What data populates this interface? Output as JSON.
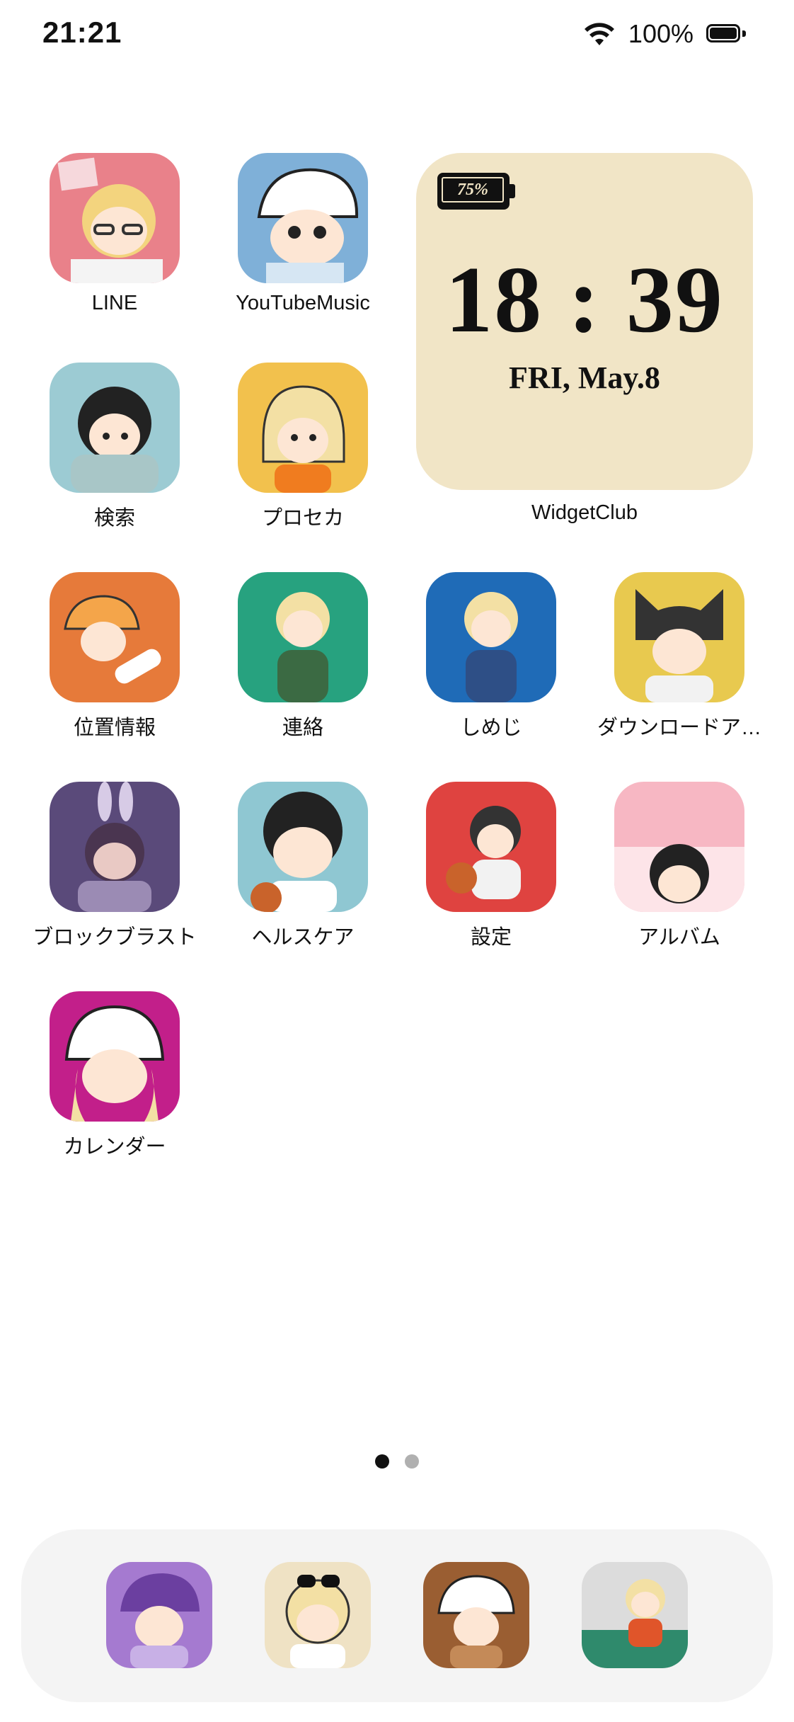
{
  "status_bar": {
    "time": "21:21",
    "battery_percent": "100%",
    "icons": [
      "wifi-icon",
      "battery-icon"
    ]
  },
  "apps": [
    {
      "label": "LINE",
      "bg": "#e9818a"
    },
    {
      "label": "YouTubeMusic",
      "bg": "#7fb0d8"
    },
    {
      "label": "検索",
      "bg": "#9ccbd3"
    },
    {
      "label": "プロセカ",
      "bg": "#f2c14d"
    },
    {
      "label": "位置情報",
      "bg": "#e67a3a"
    },
    {
      "label": "連絡",
      "bg": "#27a27f"
    },
    {
      "label": "しめじ",
      "bg": "#1f6bb7"
    },
    {
      "label": "ダウンロードア…",
      "bg": "#e8c94f"
    },
    {
      "label": "ブロックブラスト",
      "bg": "#5a4a7a"
    },
    {
      "label": "ヘルスケア",
      "bg": "#8fc7d2"
    },
    {
      "label": "設定",
      "bg": "#df4340"
    },
    {
      "label": "アルバム",
      "bg": "#f7b7c3"
    },
    {
      "label": "カレンダー",
      "bg": "#c21f8a"
    }
  ],
  "widget": {
    "battery": "75%",
    "time": "18 : 39",
    "date": "FRI, May.8",
    "label": "WidgetClub",
    "bg": "#f1e5c6"
  },
  "page_indicator": {
    "pages": 2,
    "current": 1
  },
  "dock": [
    {
      "name": "dock-app-1",
      "bg": "#a57ad0"
    },
    {
      "name": "dock-app-2",
      "bg": "#efe2c4"
    },
    {
      "name": "dock-app-3",
      "bg": "#9a5e32"
    },
    {
      "name": "dock-app-4",
      "bg": "#2f8a6c"
    }
  ]
}
